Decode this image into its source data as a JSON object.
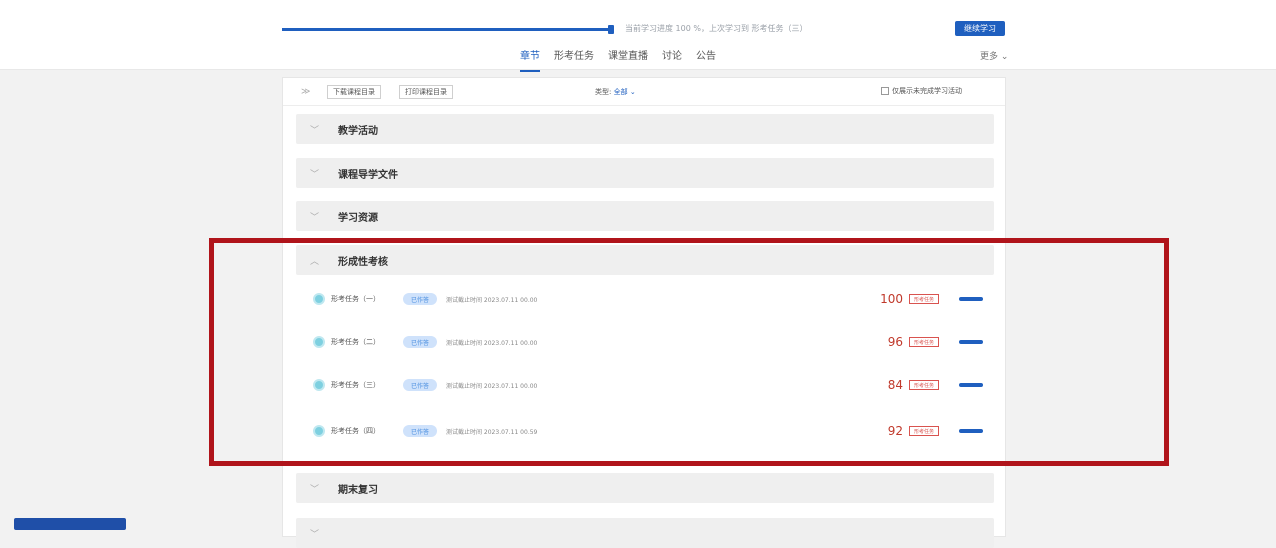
{
  "top": {
    "progress_percent": 100,
    "progress_text": "当前学习进度 100 %，上次学习到 形考任务（三）",
    "continue_label": "继续学习",
    "tabs": [
      {
        "label": "章节",
        "active": true
      },
      {
        "label": "形考任务",
        "active": false
      },
      {
        "label": "课堂直播",
        "active": false
      },
      {
        "label": "讨论",
        "active": false
      },
      {
        "label": "公告",
        "active": false
      }
    ],
    "more_label": "更多 ⌄"
  },
  "toolbar": {
    "collapse_icon": "chevron-double-down-icon",
    "download_label": "下载课程目录",
    "print_label": "打印课程目录",
    "type_label": "类型:",
    "type_value": "全部 ⌄",
    "only_unfinished_label": "仅展示未完成学习活动"
  },
  "sections": [
    {
      "title": "教学活动",
      "expanded": false
    },
    {
      "title": "课程导学文件",
      "expanded": false
    },
    {
      "title": "学习资源",
      "expanded": false
    },
    {
      "title": "形成性考核",
      "expanded": true
    },
    {
      "title": "期末复习",
      "expanded": false
    }
  ],
  "tasks": [
    {
      "name": "形考任务（一）",
      "badge": "已作答",
      "deadline": "测试截止时间 2023.07.11 00.00",
      "score": "100",
      "tag": "形考任务"
    },
    {
      "name": "形考任务（二）",
      "badge": "已作答",
      "deadline": "测试截止时间 2023.07.11 00.00",
      "score": "96",
      "tag": "形考任务"
    },
    {
      "name": "形考任务（三）",
      "badge": "已作答",
      "deadline": "测试截止时间 2023.07.11 00.00",
      "score": "84",
      "tag": "形考任务"
    },
    {
      "name": "形考任务（四）",
      "badge": "已作答",
      "deadline": "测试截止时间 2023.07.11 00.59",
      "score": "92",
      "tag": "形考任务"
    }
  ],
  "colors": {
    "accent": "#1f5fbf",
    "highlight": "#b0141b",
    "score": "#c0392b"
  }
}
